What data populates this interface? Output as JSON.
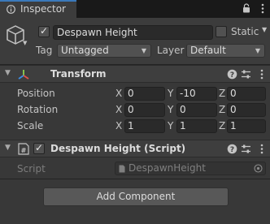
{
  "tab": {
    "label": "Inspector"
  },
  "gameobject": {
    "name": "Despawn Height",
    "active": true,
    "static_label": "Static",
    "tag_label": "Tag",
    "tag_value": "Untagged",
    "layer_label": "Layer",
    "layer_value": "Default"
  },
  "transform": {
    "title": "Transform",
    "rows": [
      {
        "label": "Position",
        "x": "0",
        "y": "-10",
        "z": "0"
      },
      {
        "label": "Rotation",
        "x": "0",
        "y": "0",
        "z": "0"
      },
      {
        "label": "Scale",
        "x": "1",
        "y": "1",
        "z": "1"
      }
    ],
    "axes": {
      "x": "X",
      "y": "Y",
      "z": "Z"
    }
  },
  "script_component": {
    "title": "Despawn Height (Script)",
    "enabled": true,
    "script_label": "Script",
    "script_value": "DespawnHeight"
  },
  "add_component_label": "Add Component",
  "colors": {
    "accent_tab": "#3a79bb",
    "background": "#383838",
    "field_bg": "#2a2a2a"
  }
}
